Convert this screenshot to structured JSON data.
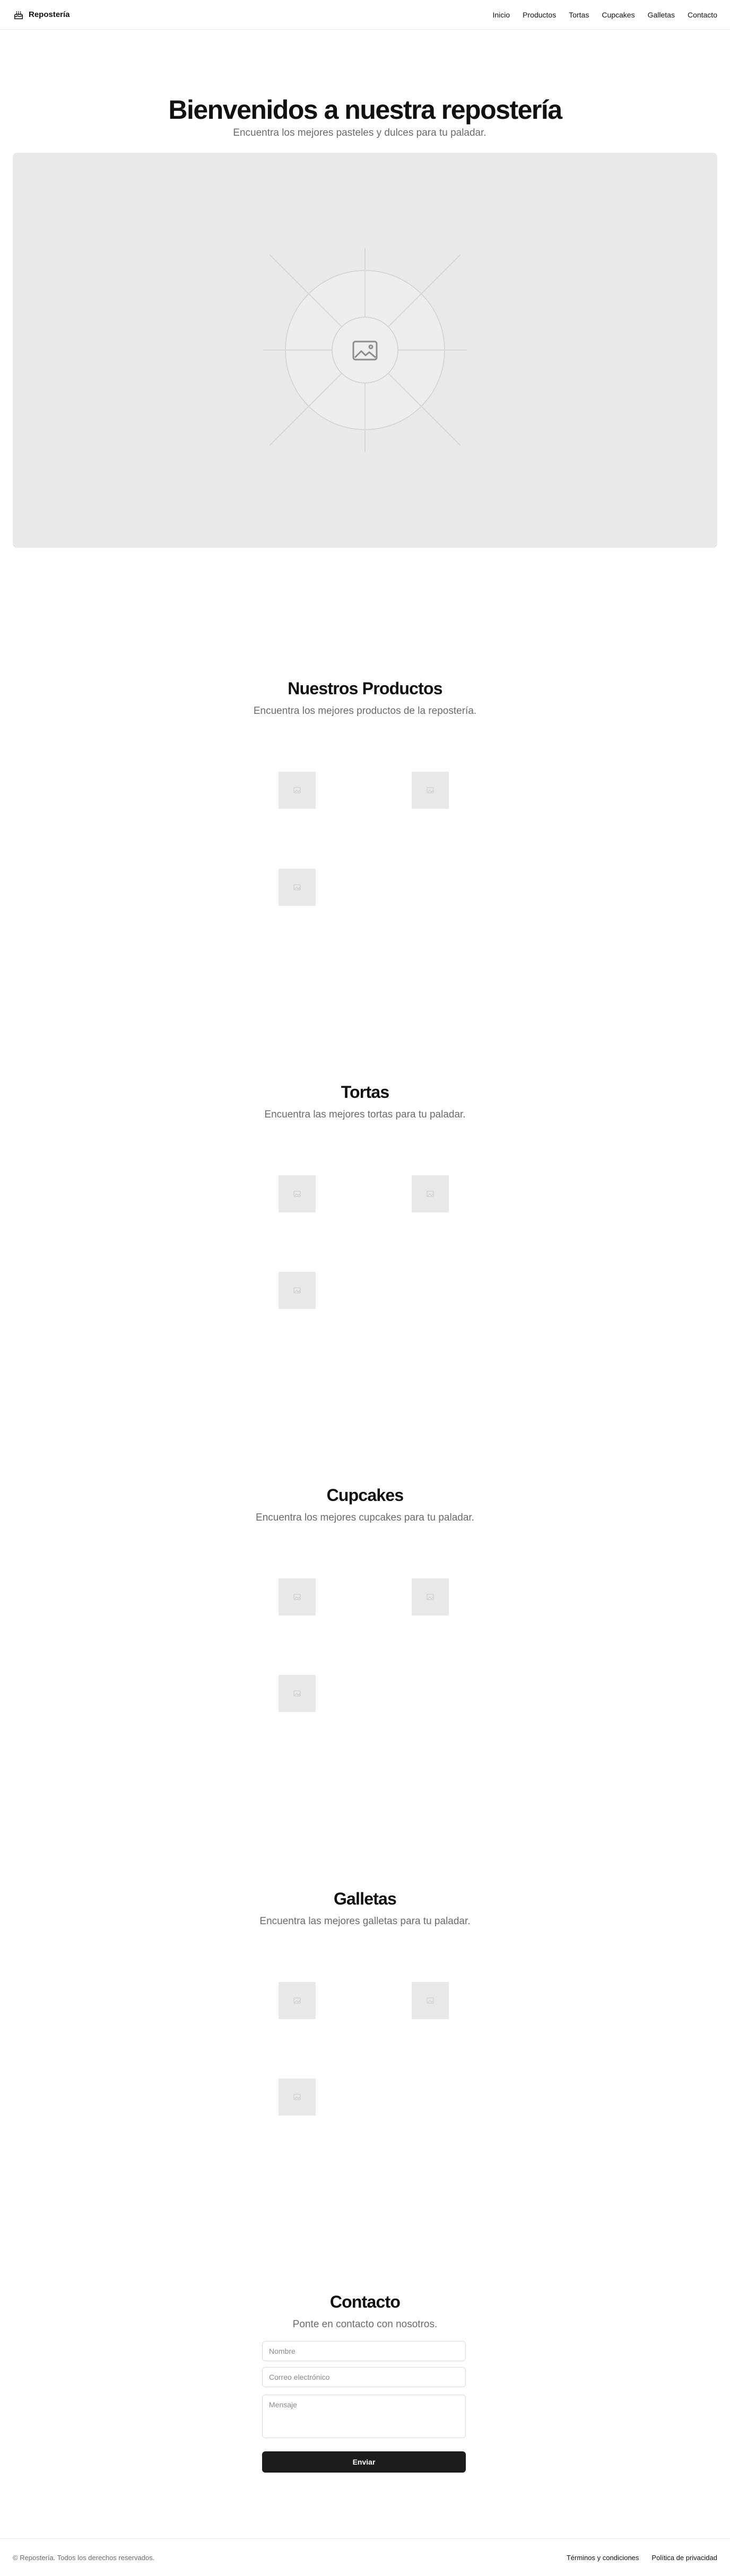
{
  "header": {
    "brand": "Repostería",
    "brand_icon": "cake-icon",
    "nav": [
      "Inicio",
      "Productos",
      "Tortas",
      "Cupcakes",
      "Galletas",
      "Contacto"
    ]
  },
  "hero": {
    "title": "Bienvenidos a nuestra repostería",
    "subtitle": "Encuentra los mejores pasteles y dulces para tu paladar.",
    "image_icon": "image-placeholder-icon"
  },
  "sections": {
    "productos": {
      "title": "Nuestros Productos",
      "subtitle": "Encuentra los mejores productos de la repostería."
    },
    "tortas": {
      "title": "Tortas",
      "subtitle": "Encuentra las mejores tortas para tu paladar."
    },
    "cupcakes": {
      "title": "Cupcakes",
      "subtitle": "Encuentra los mejores cupcakes para tu paladar."
    },
    "galletas": {
      "title": "Galletas",
      "subtitle": "Encuentra las mejores galletas para tu paladar."
    }
  },
  "contact": {
    "title": "Contacto",
    "subtitle": "Ponte en contacto con nosotros.",
    "name_placeholder": "Nombre",
    "email_placeholder": "Correo electrónico",
    "message_placeholder": "Mensaje",
    "submit_label": "Enviar"
  },
  "footer": {
    "copyright": "© Repostería. Todos los derechos reservados.",
    "links": [
      "Términos y condiciones",
      "Política de privacidad"
    ]
  },
  "colors": {
    "placeholder_bg": "#e9e9e9",
    "button_bg": "#1c1c1c",
    "muted_text": "#6b6b6b"
  }
}
